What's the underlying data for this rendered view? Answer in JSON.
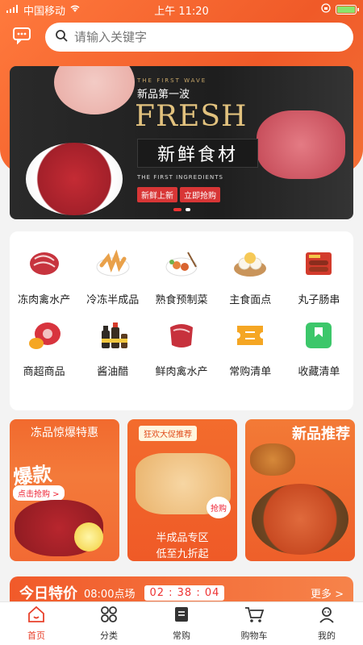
{
  "status_bar": {
    "carrier": "中国移动",
    "time": "上午 11:20"
  },
  "search": {
    "placeholder": "请输入关键字"
  },
  "banner": {
    "wave_text": "THE FIRST WAVE",
    "subtitle": "新品第一波",
    "headline": "FRESH",
    "headline_cn": "新鲜食材",
    "ingredients_text": "THE FIRST INGREDIENTS",
    "tag1": "新鲜上新",
    "tag2": "立即抢购",
    "slides": 2,
    "active_slide": 1
  },
  "categories": [
    {
      "label": "冻肉禽水产",
      "icon": "frozen-meat-icon"
    },
    {
      "label": "冷冻半成品",
      "icon": "frozen-semi-icon"
    },
    {
      "label": "熟食预制菜",
      "icon": "cooked-food-icon"
    },
    {
      "label": "主食面点",
      "icon": "dumpling-icon"
    },
    {
      "label": "丸子肠串",
      "icon": "sausage-icon"
    },
    {
      "label": "商超商品",
      "icon": "supermarket-icon"
    },
    {
      "label": "酱油醋",
      "icon": "sauce-icon"
    },
    {
      "label": "鲜肉禽水产",
      "icon": "fresh-meat-icon"
    },
    {
      "label": "常购清单",
      "icon": "ticket-icon"
    },
    {
      "label": "收藏清单",
      "icon": "bookmark-icon"
    }
  ],
  "promos": [
    {
      "title": "冻品惊爆特惠",
      "big": "爆款",
      "button": "点击抢购 >"
    },
    {
      "badge": "狂欢大促推荐",
      "sticker": "抢购",
      "line1": "半成品专区",
      "line2": "低至九折起"
    },
    {
      "title": "新品推荐"
    }
  ],
  "deal": {
    "title": "今日特价",
    "time": "08:00点场",
    "countdown": "02 : 38 : 04",
    "more": "更多 >"
  },
  "tabbar": [
    {
      "label": "首页",
      "icon": "home-icon",
      "active": true
    },
    {
      "label": "分类",
      "icon": "category-icon",
      "active": false
    },
    {
      "label": "常购",
      "icon": "list-icon",
      "active": false
    },
    {
      "label": "购物车",
      "icon": "cart-icon",
      "active": false
    },
    {
      "label": "我的",
      "icon": "user-icon",
      "active": false
    }
  ],
  "colors": {
    "accent": "#f05a28",
    "active_tab": "#e8412b"
  }
}
